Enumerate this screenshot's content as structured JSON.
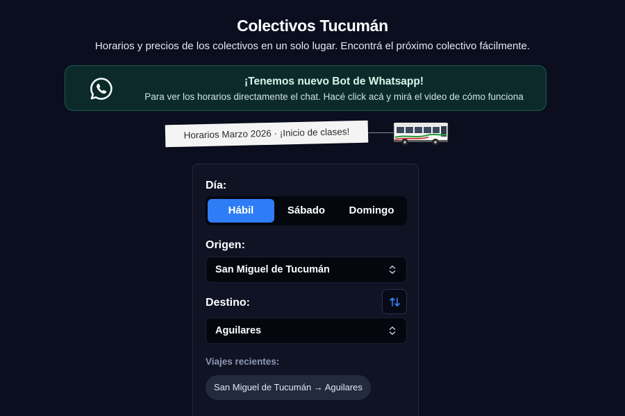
{
  "header": {
    "title": "Colectivos Tucumán",
    "subtitle": "Horarios y precios de los colectivos en un solo lugar. Encontrá el próximo colectivo fácilmente."
  },
  "whatsapp_banner": {
    "icon": "whatsapp-icon",
    "title": "¡Tenemos nuevo Bot de Whatsapp!",
    "text": "Para ver los horarios directamente el chat. Hacé click acá y mirá el video de cómo funciona",
    "accent_color": "#1c5a4c"
  },
  "notice": {
    "text": "Horarios Marzo 2026 · ¡Inicio de clases!",
    "illustration": "bus-icon"
  },
  "form": {
    "day_label": "Día:",
    "day_options": [
      {
        "label": "Hábil",
        "active": true
      },
      {
        "label": "Sábado",
        "active": false
      },
      {
        "label": "Domingo",
        "active": false
      }
    ],
    "origin_label": "Origen:",
    "origin_value": "San Miguel de Tucumán",
    "destination_label": "Destino:",
    "destination_value": "Aguilares",
    "swap_icon": "swap-arrows-icon",
    "recent_label": "Viajes recientes:",
    "recent_trips": [
      "San Miguel de Tucumán → Aguilares"
    ],
    "active_color": "#2f7df6"
  }
}
